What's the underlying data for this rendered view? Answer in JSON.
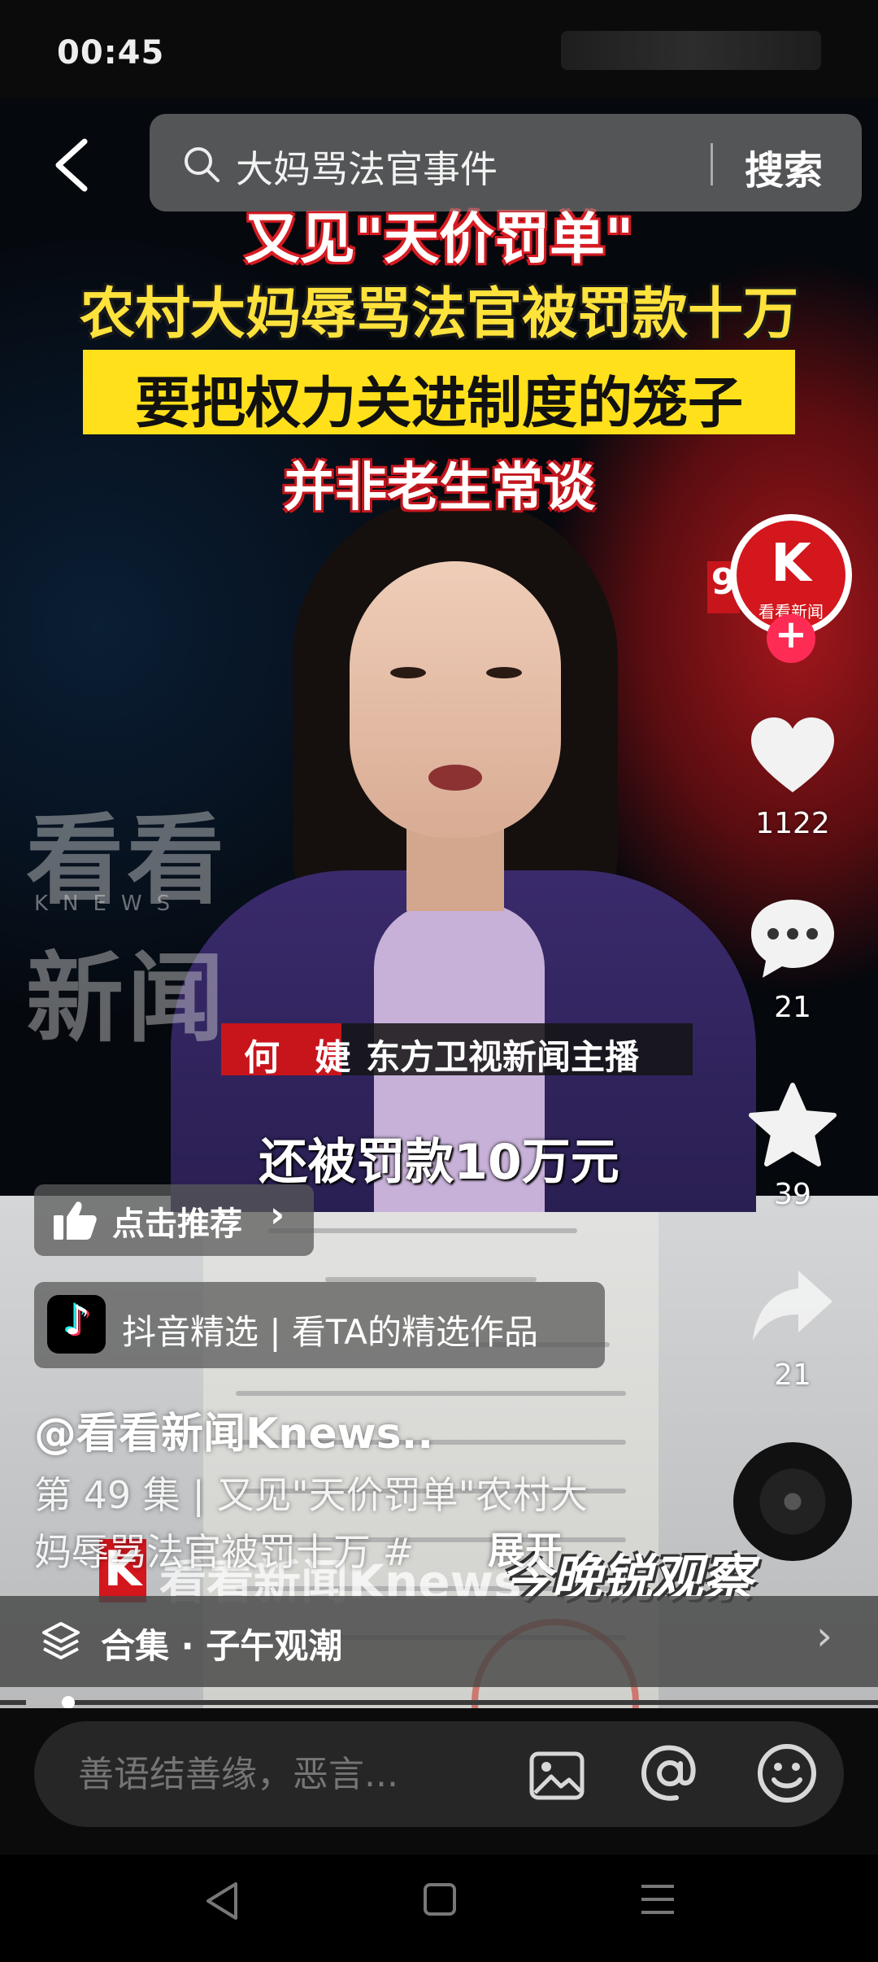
{
  "status_bar": {
    "time": "00:45"
  },
  "search": {
    "query": "大妈骂法官事件",
    "button_label": "搜索"
  },
  "video": {
    "headline": [
      "又见\"天价罚单\"",
      "农村大妈辱骂法官被罚款十万",
      "要把权力关进制度的笼子",
      "并非老生常谈"
    ],
    "watermark": {
      "top": "看看",
      "letters": "KNEWS",
      "bottom": "新闻"
    },
    "name_strip": {
      "name": "何 婕",
      "role": "东方卫视新闻主播"
    },
    "subtitle": "还被罚款10万元",
    "side_label": "9",
    "lower_brand": "看看新闻Knews",
    "lower_show": "今晚锐观察"
  },
  "right_rail": {
    "avatar_text": "看看新闻",
    "avatar_letter": "K",
    "follow": "+",
    "likes": "1122",
    "comments": "21",
    "favorites": "39",
    "shares": "21"
  },
  "overlay": {
    "recommend_label": "点击推荐",
    "recommend_chevron": "›",
    "douyin_label": "抖音精选 | 看TA的精选作品",
    "author": "@看看新闻Knews..",
    "description_line1": "第 49 集 | 又见\"天价罚单\"农村大",
    "description_line2": "妈辱骂法官被罚十万 #",
    "expand_label": "展开"
  },
  "collection": {
    "label": "合集 · 子午观潮",
    "chevron": "›"
  },
  "playback": {
    "progress": 0.05
  },
  "comment_bar": {
    "placeholder": "善语结善缘，恶言..."
  },
  "colors": {
    "brand_red": "#d4161d",
    "headline_yellow": "#ffe01a",
    "follow_pink": "#fe2c55"
  }
}
